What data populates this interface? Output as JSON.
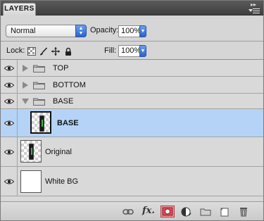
{
  "panel": {
    "tab_label": "LAYERS",
    "collapse_glyph": "▸▸",
    "blend_mode": "Normal",
    "opacity_label": "Opacity:",
    "opacity_value": "100%",
    "lock_label": "Lock:",
    "fill_label": "Fill:",
    "fill_value": "100%"
  },
  "layers": [
    {
      "name": "TOP",
      "kind": "group",
      "visible": true,
      "expanded": false,
      "indent": 0,
      "selected": false
    },
    {
      "name": "BOTTOM",
      "kind": "group",
      "visible": true,
      "expanded": false,
      "indent": 0,
      "selected": false
    },
    {
      "name": "BASE",
      "kind": "group",
      "visible": true,
      "expanded": true,
      "indent": 0,
      "selected": false
    },
    {
      "name": "BASE",
      "kind": "layer",
      "visible": true,
      "indent": 1,
      "selected": true,
      "thumbnail": "transparent-object"
    },
    {
      "name": "Original",
      "kind": "layer",
      "visible": true,
      "indent": 0,
      "selected": false,
      "thumbnail": "transparent-object"
    },
    {
      "name": "White BG",
      "kind": "layer",
      "visible": true,
      "indent": 0,
      "selected": false,
      "thumbnail": "white"
    }
  ],
  "footer_icons": [
    "link-icon",
    "fx-icon",
    "layer-mask-icon",
    "adjustment-layer-icon",
    "new-group-icon",
    "new-layer-icon",
    "trash-icon"
  ],
  "footer": {
    "fx_label": "fx."
  },
  "colors": {
    "selection": "#b5d3f7",
    "accent_blue": "#2c63c8",
    "mask_button": "#e04c5a"
  }
}
